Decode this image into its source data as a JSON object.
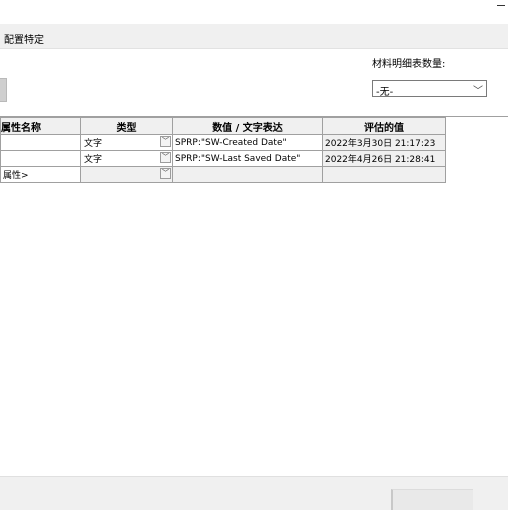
{
  "tab": {
    "label": "配置特定"
  },
  "bom": {
    "label": "材料明细表数量:",
    "selected": "-无-"
  },
  "table": {
    "headers": [
      "属性名称",
      "类型",
      "数值 / 文字表达",
      "评估的值"
    ],
    "rows": [
      {
        "name": "",
        "type": "文字",
        "value": "SPRP:\"SW-Created Date\"",
        "evaluated": "2022年3月30日 21:17:23"
      },
      {
        "name": "",
        "type": "文字",
        "value": "SPRP:\"SW-Last Saved Date\"",
        "evaluated": "2022年4月26日 21:28:41"
      },
      {
        "name": "属性>",
        "type": "",
        "value": "",
        "evaluated": ""
      }
    ]
  },
  "icons": {
    "dropdown": "chevron-down-icon",
    "minimize": "minimize-icon"
  }
}
